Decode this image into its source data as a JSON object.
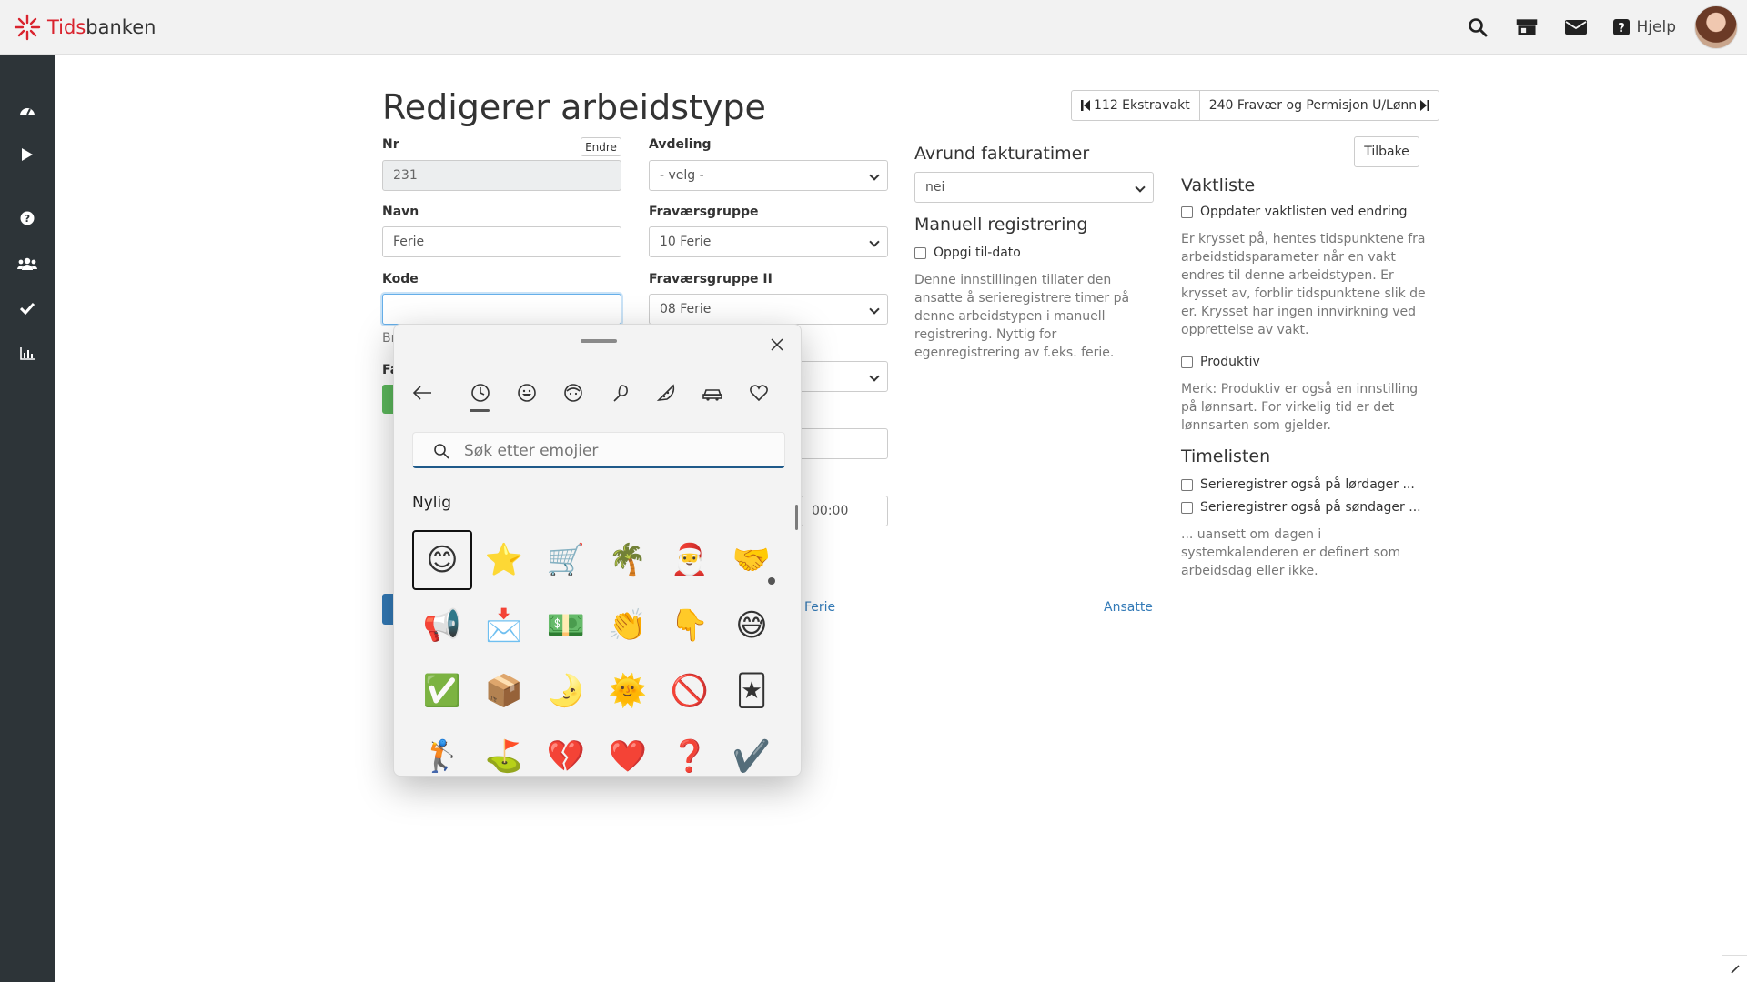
{
  "brand": {
    "name_accent": "Tids",
    "name_rest": "banken"
  },
  "header": {
    "help_label": "Hjelp"
  },
  "page": {
    "title": "Redigerer arbeidstype",
    "prev_label": "112 Ekstravakt",
    "next_label": "240 Fravær og Permisjon U/Lønn",
    "back_label": "Tilbake"
  },
  "form": {
    "nr_label": "Nr",
    "nr_value": "231",
    "endre_label": "Endre",
    "navn_label": "Navn",
    "navn_value": "Ferie",
    "kode_label": "Kode",
    "kode_value": "",
    "avdeling_label": "Avdeling",
    "avdeling_value": "- velg -",
    "fravaersgruppe_label": "Fraværsgruppe",
    "fravaersgruppe_value": "10 Ferie",
    "fravaersgruppe2_label": "Fraværsgruppe II",
    "fravaersgruppe2_value": "08 Ferie",
    "time_value": "00:00",
    "frag_br": "Br",
    "frag_fa": "Fa",
    "ferie_link": "Ferie",
    "ansatte_link": "Ansatte"
  },
  "right": {
    "avrund_title": "Avrund fakturatimer",
    "avrund_value": "nei",
    "manuell_title": "Manuell registrering",
    "oppgi_label": "Oppgi til-dato",
    "manuell_help": "Denne innstillingen tillater den ansatte å serieregistrere timer på denne arbeidstypen i manuell registrering. Nyttig for egenregistrering av f.eks. ferie.",
    "vaktliste_title": "Vaktliste",
    "oppdater_label": "Oppdater vaktlisten ved endring",
    "vaktliste_help": "Er krysset på, hentes tidspunktene fra arbeidstidsparameter når en vakt endres til denne arbeidstypen. Er krysset av, forblir tidspunktene slik de er. Krysset har ingen innvirkning ved opprettelse av vakt.",
    "produktiv_label": "Produktiv",
    "produktiv_help": "Merk: Produktiv er også en innstilling på lønnsart. For virkelig tid er det lønnsarten som gjelder.",
    "timelisten_title": "Timelisten",
    "lordager_label": "Serieregistrer også på lørdager ...",
    "sondager_label": "Serieregistrer også på søndager ...",
    "timelisten_help": "... uansett om dagen i systemkalenderen er definert som arbeidsdag eller ikke."
  },
  "emoji_panel": {
    "search_placeholder": "Søk etter emojier",
    "section_label": "Nylig",
    "emojis": [
      "😊",
      "⭐",
      "🛒",
      "🌴",
      "🎅",
      "🤝",
      "📢",
      "📩",
      "💵",
      "👏",
      "👇",
      "😅",
      "✅",
      "📦",
      "🌛",
      "🌞",
      "🚫",
      "🃏",
      "🏌",
      "⛳",
      "💔",
      "❤️",
      "❓",
      "✔️"
    ]
  }
}
